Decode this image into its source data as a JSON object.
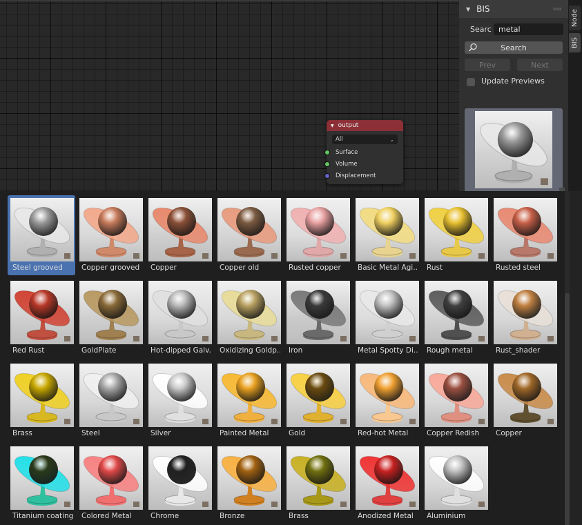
{
  "node_editor": {
    "node": {
      "title": "output",
      "target_select": "All",
      "sockets": [
        {
          "label": "Surface",
          "color": "#63c763"
        },
        {
          "label": "Volume",
          "color": "#63c763"
        },
        {
          "label": "Displacement",
          "color": "#6363c7"
        }
      ],
      "header_color": "#8c2f36"
    }
  },
  "sidebar": {
    "panel_title": "BIS",
    "search_label": "Searc",
    "search_value": "metal",
    "search_button": "Search",
    "prev_button": "Prev",
    "next_button": "Next",
    "update_previews_label": "Update Previews",
    "update_previews_checked": false,
    "tabs": [
      {
        "label": "Node",
        "active": false
      },
      {
        "label": "BIS",
        "active": true
      }
    ],
    "preview": {
      "material": "Steel grooved"
    }
  },
  "gallery": {
    "selected_index": 0,
    "accent_color": "#4a72b0",
    "items": [
      {
        "label": "Steel grooved",
        "ring": "#e8e8e8",
        "sphere": "#9a9a9a",
        "base": "#b0b0b0",
        "bg": "#d0d0d0"
      },
      {
        "label": "Copper grooved",
        "ring": "#f2a88a",
        "sphere": "#c77a5a",
        "base": "#d08a6a",
        "bg": "#d8d8d8"
      },
      {
        "label": "Copper",
        "ring": "#e8876a",
        "sphere": "#8a4f36",
        "base": "#a86448",
        "bg": "#cfcfcf"
      },
      {
        "label": "Copper old",
        "ring": "#e89a7c",
        "sphere": "#7a5a40",
        "base": "#9a6a50",
        "bg": "#d4d4d4"
      },
      {
        "label": "Rusted copper",
        "ring": "#f0b0b0",
        "sphere": "#e8a0a0",
        "base": "#e0a8a8",
        "bg": "#dcdcdc"
      },
      {
        "label": "Basic Metal Agi..",
        "ring": "#f2dc80",
        "sphere": "#f0d060",
        "base": "#e8d490",
        "bg": "#dadada"
      },
      {
        "label": "Rust",
        "ring": "#f0d040",
        "sphere": "#e8c030",
        "base": "#e8c848",
        "bg": "#d8d8d8"
      },
      {
        "label": "Rusted steel",
        "ring": "#e88870",
        "sphere": "#c86048",
        "base": "#b8786a",
        "bg": "#d4d4d4"
      },
      {
        "label": "Red Rust",
        "ring": "#d04030",
        "sphere": "#b83828",
        "base": "#c05040",
        "bg": "#cfcfcf"
      },
      {
        "label": "GoldPlate",
        "ring": "#b89860",
        "sphere": "#8a6a38",
        "base": "#a08050",
        "bg": "#cfcfcf"
      },
      {
        "label": "Hot-dipped Galv..",
        "ring": "#e0e0e0",
        "sphere": "#b8b8b8",
        "base": "#c8c8c8",
        "bg": "#dadada"
      },
      {
        "label": "Oxidizing Goldp..",
        "ring": "#e8dc98",
        "sphere": "#b8a060",
        "base": "#c8b880",
        "bg": "#d8d8d8"
      },
      {
        "label": "Iron",
        "ring": "#787878",
        "sphere": "#3a3a3a",
        "base": "#6a6a6a",
        "bg": "#cacaca"
      },
      {
        "label": "Metal Spotty Di..",
        "ring": "#e8e8e8",
        "sphere": "#c0c0c0",
        "base": "#d0d0d0",
        "bg": "#dcdcdc"
      },
      {
        "label": "Rough metal",
        "ring": "#5a5a5a",
        "sphere": "#404040",
        "base": "#505050",
        "bg": "#d2d2d2"
      },
      {
        "label": "Rust_shader",
        "ring": "#e8e0d8",
        "sphere": "#c08040",
        "base": "#d0b090",
        "bg": "#d8d8d8"
      },
      {
        "label": "Brass",
        "ring": "#f0d020",
        "sphere": "#c8a800",
        "base": "#d8b820",
        "bg": "#d4d4d4"
      },
      {
        "label": "Steel",
        "ring": "#f0f0f0",
        "sphere": "#a8a8a8",
        "base": "#c8c8c8",
        "bg": "#d8d8d8"
      },
      {
        "label": "Silver",
        "ring": "#ffffff",
        "sphere": "#c8c8c8",
        "base": "#e0e0e0",
        "bg": "#dadada"
      },
      {
        "label": "Painted Metal",
        "ring": "#f8b830",
        "sphere": "#e8a020",
        "base": "#f0b040",
        "bg": "#d8d8d8"
      },
      {
        "label": "Gold",
        "ring": "#f8d040",
        "sphere": "#6a4a10",
        "base": "#e0b030",
        "bg": "#d4d4d4"
      },
      {
        "label": "Red-hot Metal",
        "ring": "#f8b878",
        "sphere": "#f0a030",
        "base": "#f8c890",
        "bg": "#dcdcdc"
      },
      {
        "label": "Copper Redish",
        "ring": "#f8a898",
        "sphere": "#9a5040",
        "base": "#e09080",
        "bg": "#d8d8d8"
      },
      {
        "label": "Copper",
        "ring": "#c88a48",
        "sphere": "#a06828",
        "base": "#605030",
        "bg": "#d4d4d4"
      },
      {
        "label": "Titanium coating",
        "ring": "#20e0e8",
        "sphere": "#2a3a1a",
        "base": "#30c0a0",
        "bg": "#d4d4d4"
      },
      {
        "label": "Colored Metal",
        "ring": "#f88080",
        "sphere": "#e04848",
        "base": "#f07070",
        "bg": "#d8d8d8"
      },
      {
        "label": "Chrome",
        "ring": "#ffffff",
        "sphere": "#202020",
        "base": "#e8e8e8",
        "bg": "#d0d0d0"
      },
      {
        "label": "Bronze",
        "ring": "#f8b040",
        "sphere": "#a06010",
        "base": "#d08020",
        "bg": "#d4d4d4"
      },
      {
        "label": "Brass",
        "ring": "#c8b020",
        "sphere": "#707010",
        "base": "#a89818",
        "bg": "#d0d0d0"
      },
      {
        "label": "Anodized Metal",
        "ring": "#f03030",
        "sphere": "#c82020",
        "base": "#e04040",
        "bg": "#d4d4d4"
      },
      {
        "label": "Aluminium",
        "ring": "#ffffff",
        "sphere": "#c0c0c0",
        "base": "#e0e0e0",
        "bg": "#d8d8d8"
      }
    ]
  }
}
